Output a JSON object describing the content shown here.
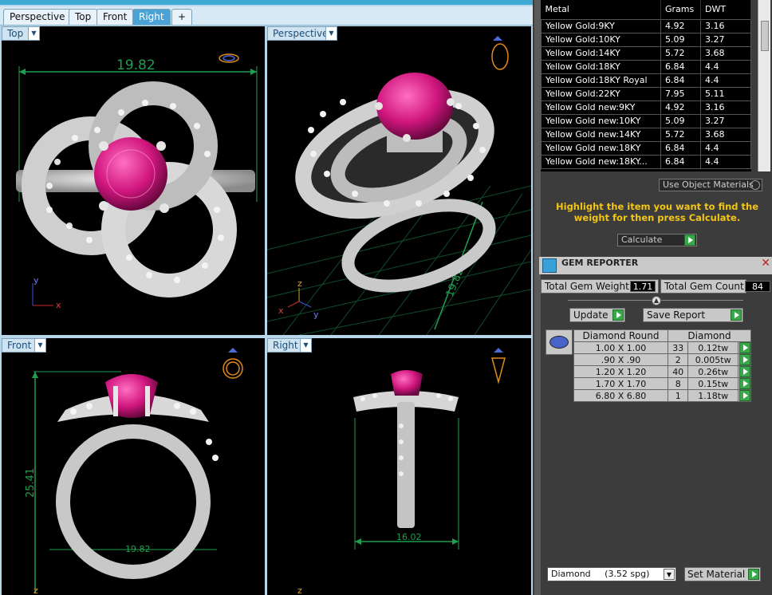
{
  "tabs": [
    {
      "label": "Perspective",
      "active": false
    },
    {
      "label": "Top",
      "active": false
    },
    {
      "label": "Front",
      "active": false
    },
    {
      "label": "Right",
      "active": true
    }
  ],
  "tab_add_label": "+",
  "viewports": {
    "top": {
      "label": "Top",
      "dimension": "19.82",
      "axis_y": "y",
      "axis_x": "x"
    },
    "perspective": {
      "label": "Perspective",
      "dimension": "19.82",
      "axis_z": "z",
      "axis_y": "y",
      "axis_x": "x"
    },
    "front": {
      "label": "Front",
      "dimension_v": "25.41",
      "dimension_h": "19.82",
      "axis_z": "z"
    },
    "right": {
      "label": "Right",
      "dimension": "16.02",
      "axis_z": "z"
    }
  },
  "metal_table": {
    "headers": [
      "Metal",
      "Grams",
      "DWT"
    ],
    "rows": [
      [
        "Yellow Gold:9KY",
        "4.92",
        "3.16"
      ],
      [
        "Yellow Gold:10KY",
        "5.09",
        "3.27"
      ],
      [
        "Yellow Gold:14KY",
        "5.72",
        "3.68"
      ],
      [
        "Yellow Gold:18KY",
        "6.84",
        "4.4"
      ],
      [
        "Yellow Gold:18KY Royal",
        "6.84",
        "4.4"
      ],
      [
        "Yellow Gold:22KY",
        "7.95",
        "5.11"
      ],
      [
        "Yellow Gold new:9KY",
        "4.92",
        "3.16"
      ],
      [
        "Yellow Gold new:10KY",
        "5.09",
        "3.27"
      ],
      [
        "Yellow Gold new:14KY",
        "5.72",
        "3.68"
      ],
      [
        "Yellow Gold new:18KY",
        "6.84",
        "4.4"
      ],
      [
        "Yellow Gold new:18KY...",
        "6.84",
        "4.4"
      ]
    ]
  },
  "use_object_materials": "Use Object Materials",
  "hint_text": "Highlight the item you want to find the weight for then press Calculate.",
  "calculate_label": "Calculate",
  "gem_reporter": {
    "title": "GEM REPORTER",
    "total_weight_label": "Total Gem Weight",
    "total_weight_value": "1.71",
    "total_count_label": "Total Gem Count",
    "total_count_value": "84",
    "update_label": "Update",
    "save_report_label": "Save Report",
    "table_headers": [
      "Diamond Round",
      "Diamond"
    ],
    "rows": [
      [
        "1.00 X 1.00",
        "33",
        "0.12tw"
      ],
      [
        ".90 X .90",
        "2",
        "0.005tw"
      ],
      [
        "1.20 X 1.20",
        "40",
        "0.26tw"
      ],
      [
        "1.70 X 1.70",
        "8",
        "0.15tw"
      ],
      [
        "6.80 X 6.80",
        "1",
        "1.18tw"
      ]
    ]
  },
  "material_select": "Diamond     (3.52 spg)",
  "set_material_label": "Set Material",
  "colors": {
    "accent": "#3fa9d6",
    "gem": "#d0167e",
    "hint": "#f3c516",
    "green": "#39a84a",
    "dim": "#1f9e4f"
  }
}
